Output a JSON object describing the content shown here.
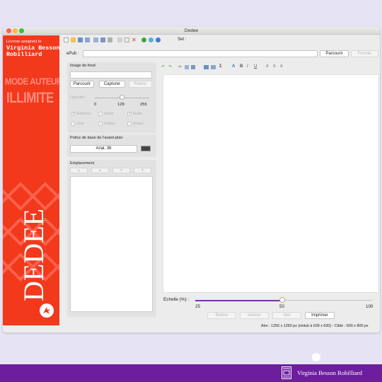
{
  "window": {
    "title": "Dedee"
  },
  "branding": {
    "license_label": "License assigned to",
    "license_name": "Virginia Besson Robilliard",
    "mode_label": "MODE AUTEUR",
    "mode_value": "ILLIMITE",
    "app_name": "DEDEE"
  },
  "toolbar": {
    "set_label": "Set :"
  },
  "epub": {
    "label": "ePub :",
    "value": "",
    "browse_label": "Parcourir",
    "close_label": "Fermer"
  },
  "background_image": {
    "title": "Image de fond",
    "value": "",
    "browse_label": "Parcourir",
    "capture_label": "Capturer",
    "remove_label": "Retirer",
    "opacity_label": "Opacité :",
    "opacity_ticks": [
      "0",
      "128",
      "255"
    ],
    "opacity_value": 128,
    "options": [
      {
        "label": "Rétrécir",
        "checked": true
      },
      {
        "label": "Etirer",
        "checked": false
      },
      {
        "label": "Ratio",
        "checked": true
      },
      {
        "label": "Gris",
        "checked": false
      },
      {
        "label": "Faible",
        "checked": false
      },
      {
        "label": "Mono",
        "checked": false
      }
    ]
  },
  "foreground_font": {
    "title": "Police de base de l'avant-plan",
    "value": "Arial, 36",
    "color": "#444444"
  },
  "placement": {
    "title": "Emplacement"
  },
  "scale": {
    "label": "Echelle (%) :",
    "ticks": [
      "25",
      "50",
      "100"
    ],
    "value": 50,
    "fill_color": "#7d2ea3"
  },
  "actions": {
    "remove_label": "Retirer",
    "insert_label": "Insérer",
    "view_label": "Voir",
    "print_label": "Imprimer"
  },
  "status": "Aire : 1256 x 1260 px (réduit à 628 x 630) - Cible : 600 x 800 px",
  "footer": {
    "brand_name": "Virginia Besson Robilliard"
  },
  "colors": {
    "accent_red": "#f2391c",
    "footer_purple": "#6d1e9e",
    "page_bg": "#e6e4f4"
  }
}
